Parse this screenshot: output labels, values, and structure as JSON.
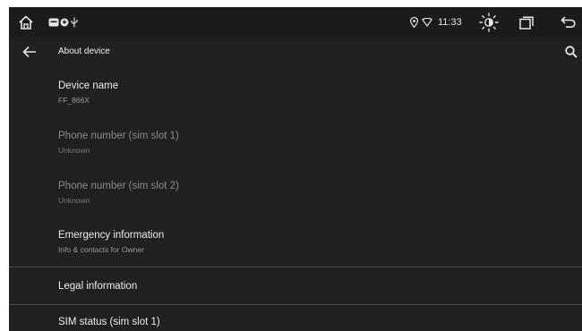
{
  "status_bar": {
    "time": "11:33",
    "icons": [
      "home-icon",
      "notification-icon",
      "usb-icon",
      "location-icon",
      "wifi-icon",
      "brightness-icon",
      "recent-apps-icon",
      "back-nav-icon"
    ]
  },
  "app_bar": {
    "title": "About device",
    "back_icon": "arrow-left-icon",
    "search_icon": "search-icon"
  },
  "items": [
    {
      "title": "Device name",
      "summary": "FF_866X",
      "enabled": true
    },
    {
      "title": "Phone number (sim slot 1)",
      "summary": "Unknown",
      "enabled": false
    },
    {
      "title": "Phone number (sim slot 2)",
      "summary": "Unknown",
      "enabled": false
    },
    {
      "title": "Emergency information",
      "summary": "Info & contacts for Owner",
      "enabled": true
    },
    {
      "title": "Legal information",
      "enabled": true
    },
    {
      "title": "SIM status (sim slot 1)",
      "enabled": true
    }
  ],
  "colors": {
    "background": "#202020",
    "status_bar": "#1b1b1b",
    "primary_text": "#ececec",
    "secondary_text": "#9a9a9a",
    "divider": "#4a4a4a"
  }
}
